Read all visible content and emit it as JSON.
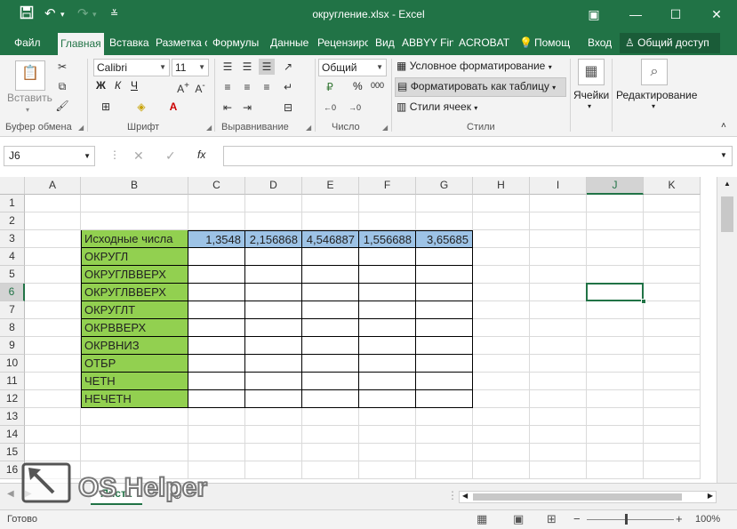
{
  "titlebar": {
    "title": "округление.xlsx - Excel",
    "save_icon": "save-icon",
    "undo_icon": "undo-icon",
    "redo_icon": "redo-icon"
  },
  "tabs": {
    "file": "Файл",
    "home": "Главная",
    "insert": "Вставка",
    "layout": "Разметка с",
    "formulas": "Формулы",
    "data": "Данные",
    "review": "Рецензиро",
    "view": "Вид",
    "abbyy": "ABBYY Fin",
    "acrobat": "ACROBAT",
    "help": "Помощ",
    "signin": "Вход",
    "share": "Общий доступ"
  },
  "ribbon": {
    "clipboard": {
      "paste": "Вставить",
      "label": "Буфер обмена"
    },
    "font": {
      "name": "Calibri",
      "size": "11",
      "label": "Шрифт",
      "bold": "Ж",
      "italic": "К",
      "underline": "Ч"
    },
    "alignment": {
      "label": "Выравнивание"
    },
    "number": {
      "format": "Общий",
      "label": "Число",
      "percent": "%",
      "comma": "000"
    },
    "styles": {
      "conditional": "Условное форматирование",
      "format_table": "Форматировать как таблицу",
      "cell_styles": "Стили ячеек",
      "label": "Стили"
    },
    "cells": {
      "label": "Ячейки"
    },
    "editing": {
      "label": "Редактирование"
    }
  },
  "formula_bar": {
    "name_box": "J6",
    "fx": "fx",
    "value": ""
  },
  "columns": [
    "A",
    "B",
    "C",
    "D",
    "E",
    "F",
    "G",
    "H",
    "I",
    "J",
    "K"
  ],
  "selected_column": "J",
  "rows": [
    "1",
    "2",
    "3",
    "4",
    "5",
    "6",
    "7",
    "8",
    "9",
    "10",
    "11",
    "12",
    "13",
    "14",
    "15",
    "16"
  ],
  "selected_row": "6",
  "table": {
    "header_label": "Исходные числа",
    "values": [
      "1,3548",
      "2,156868",
      "4,546887",
      "1,556688",
      "3,65685"
    ],
    "functions": [
      "ОКРУГЛ",
      "ОКРУГЛВВЕРХ",
      "ОКРУГЛВВЕРХ",
      "ОКРУГЛТ",
      "ОКРВВЕРХ",
      "ОКРВНИЗ",
      "ОТБР",
      "ЧЕТН",
      "НЕЧЕТН"
    ]
  },
  "sheet_tab": "Лист1",
  "status": {
    "ready": "Готово",
    "zoom": "100%"
  },
  "watermark": "OS Helper"
}
